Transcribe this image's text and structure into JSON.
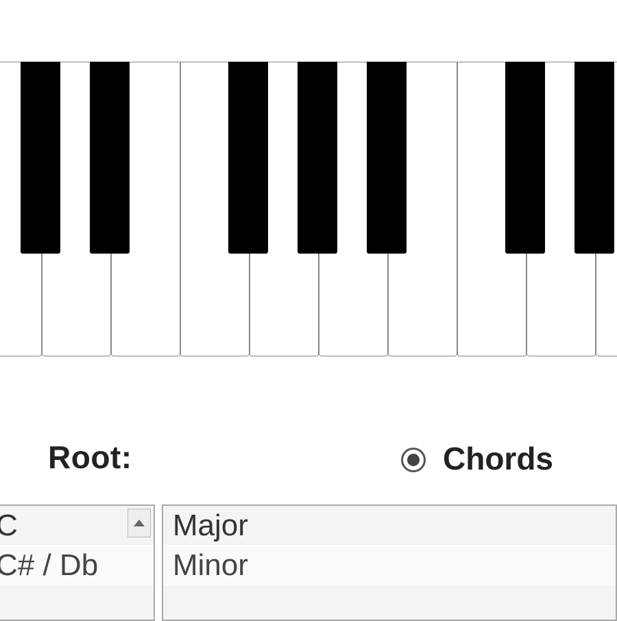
{
  "labels": {
    "root": "Root:",
    "chords": "Chords"
  },
  "radio": {
    "chords_checked": "checked"
  },
  "root_list": {
    "option0": "C",
    "option1": "C# / Db"
  },
  "chords_list": {
    "option0": "Major",
    "option1": "Minor"
  }
}
